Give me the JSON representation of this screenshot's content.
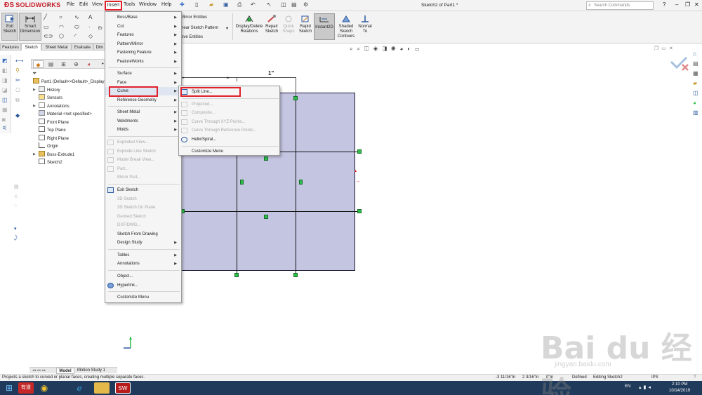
{
  "app": {
    "brand": "SOLIDWORKS",
    "document_title": "Sketch2 of Part1 *",
    "search_placeholder": "Search Commands"
  },
  "menubar": {
    "items": [
      "File",
      "Edit",
      "View",
      "Insert",
      "Tools",
      "Window",
      "Help"
    ]
  },
  "commands": {
    "exit_sketch": "Exit Sketch",
    "smart_dimension": "Smart Dimension",
    "mirror_entities": "Mirror Entities",
    "linear_sketch_pattern": "near Sketch Pattern",
    "move_entities": "ove Entities",
    "display_delete_relations": "Display/Delete Relations",
    "repair_sketch": "Repair Sketch",
    "quick_snaps": "Quick Snaps",
    "rapid_sketch": "Rapid Sketch",
    "instant2d": "Instant2D",
    "shaded_sketch_contours": "Shaded Sketch Contours",
    "normal_to": "Normal To"
  },
  "command_tabs": [
    "Features",
    "Sketch",
    "Sheet Metal",
    "Evaluate",
    "Dim"
  ],
  "feature_tree": {
    "root": "Part1  (Default<<Default>_Display",
    "items": [
      "History",
      "Sensors",
      "Annotations",
      "Material <not specified>",
      "Front Plane",
      "Top Plane",
      "Right Plane",
      "Origin",
      "Boss-Extrude1",
      "Sketch2"
    ]
  },
  "insert_menu": {
    "items": [
      {
        "label": "Boss/Base"
      },
      {
        "label": "Cut"
      },
      {
        "label": "Features"
      },
      {
        "label": "Pattern/Mirror"
      },
      {
        "label": "Fastening Feature"
      },
      {
        "label": "FeatureWorks"
      },
      {
        "label": "Surface"
      },
      {
        "label": "Face"
      },
      {
        "label": "Curve"
      },
      {
        "label": "Reference Geometry"
      },
      {
        "label": "Sheet Metal"
      },
      {
        "label": "Weldments"
      },
      {
        "label": "Molds"
      },
      {
        "label": "Exploded View..."
      },
      {
        "label": "Explode Line Sketch"
      },
      {
        "label": "Model Break View..."
      },
      {
        "label": "Part..."
      },
      {
        "label": "Mirror Part..."
      },
      {
        "label": "Exit Sketch"
      },
      {
        "label": "3D Sketch"
      },
      {
        "label": "3D Sketch On Plane"
      },
      {
        "label": "Derived Sketch"
      },
      {
        "label": "DXF/DWG..."
      },
      {
        "label": "Sketch From Drawing"
      },
      {
        "label": "Design Study"
      },
      {
        "label": "Tables"
      },
      {
        "label": "Annotations"
      },
      {
        "label": "Object..."
      },
      {
        "label": "Hyperlink..."
      },
      {
        "label": "Customize Menu"
      }
    ]
  },
  "curve_menu": {
    "items": [
      {
        "label": "Split Line..."
      },
      {
        "label": "Projected..."
      },
      {
        "label": "Composite..."
      },
      {
        "label": "Curve Through XYZ Points..."
      },
      {
        "label": "Curve Through Reference Points..."
      },
      {
        "label": "Helix/Spiral..."
      },
      {
        "label": "Customize Menu"
      }
    ]
  },
  "dimension": {
    "value": "1\""
  },
  "bottom_tabs": [
    "Model",
    "Motion Study 1"
  ],
  "status": {
    "message": "Projects a sketch to curved or planar faces, creating multiple separate faces.",
    "coord_x": "-3 11/16\"in",
    "coord_y": "2 3/16\"in",
    "coord_z": "0\"in",
    "state": "Defined",
    "editing": "Editing Sketch2",
    "units": "IPS"
  },
  "taskbar": {
    "lang": "EN",
    "time": "2:10 PM",
    "date": "10/14/2019"
  },
  "watermark": {
    "text": "Bai du 经验",
    "sub": "jingyan.baidu.com"
  },
  "colors": {
    "part_face": "#c4c5e0",
    "highlight_box": "#e0202a",
    "point": "#2cc04a",
    "brand": "#c8202a"
  }
}
